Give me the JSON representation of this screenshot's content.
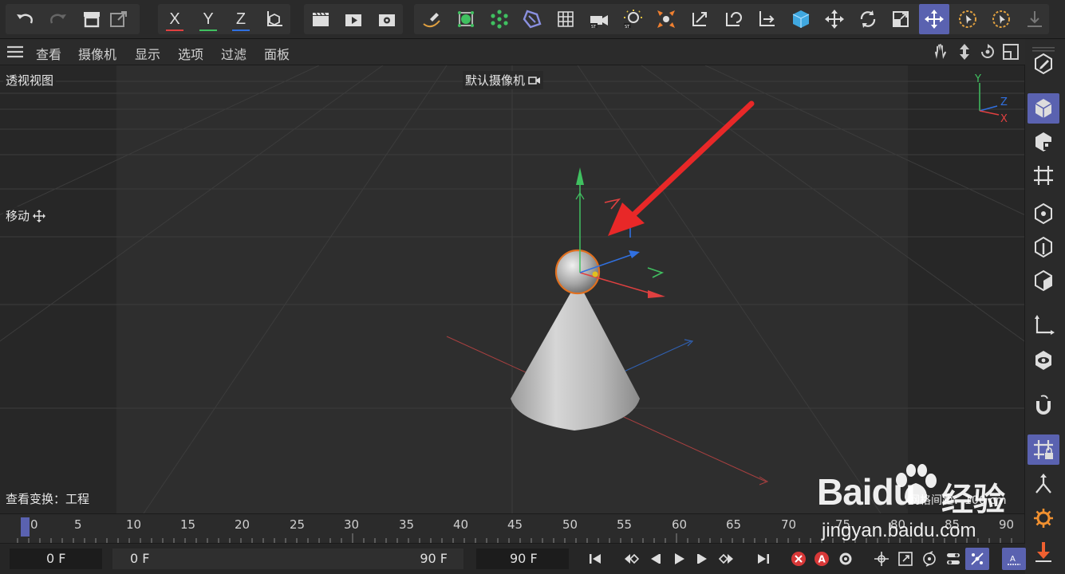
{
  "toolbar": {
    "axis_x": "X",
    "axis_y": "Y",
    "axis_z": "Z"
  },
  "menu": {
    "items": [
      "查看",
      "摄像机",
      "显示",
      "选项",
      "过滤",
      "面板"
    ]
  },
  "viewport": {
    "view_name": "透视视图",
    "camera_name": "默认摄像机",
    "tool_name": "移动",
    "view_transform": "查看变换：工程",
    "grid_spacing": "网格间距：100 cm",
    "axis_labels": {
      "y": "Y",
      "z": "Z",
      "x": "X"
    }
  },
  "timeline": {
    "ticks": [
      "0",
      "5",
      "10",
      "15",
      "20",
      "25",
      "30",
      "35",
      "40",
      "45",
      "50",
      "55",
      "60",
      "65",
      "70",
      "75",
      "80",
      "85",
      "90"
    ],
    "current_frame_marker": "0"
  },
  "bottombar": {
    "current_frame": "0 F",
    "range_start": "0 F",
    "range_end": "90 F",
    "end_frame": "90 F"
  },
  "watermark": {
    "brand": "Baidu",
    "suffix": "经验",
    "url": "jingyan.baidu.com"
  },
  "colors": {
    "accent": "#5a62b0",
    "axis_x": "#e04040",
    "axis_y": "#40c060",
    "axis_z": "#3070e0",
    "selection": "#e07020"
  }
}
